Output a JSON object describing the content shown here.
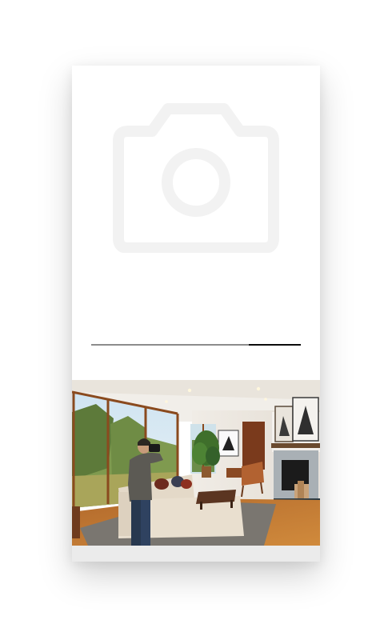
{
  "image_placeholder": {
    "icon": "camera-icon",
    "icon_color": "#f2f2f2"
  },
  "progress": {
    "value_fraction": 0.25,
    "track_color": "#8c8c8c",
    "fill_color": "#0b0b0b"
  },
  "photo": {
    "icon": "photo-living-room-photographer"
  }
}
